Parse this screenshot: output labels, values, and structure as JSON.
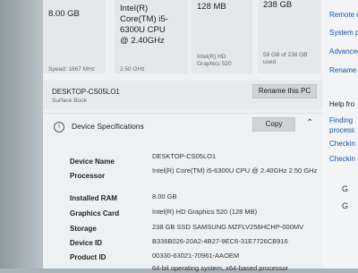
{
  "tiles": [
    {
      "value": "8.00 GB",
      "sub": "Speed: 1867 MHz"
    },
    {
      "value": "Intel(R) Core(TM) i5-6300U CPU @ 2.40GHz",
      "sub": "2.50 GHz"
    },
    {
      "value": "128 MB",
      "sub": "Intel(R) HD Graphics 520"
    },
    {
      "value": "238 GB",
      "sub": "59 GB of 238 GB used"
    }
  ],
  "device": {
    "name": "DESKTOP-CS05LO1",
    "model": "Surface Book",
    "rename_label": "Rename this PC"
  },
  "specs_section": {
    "title": "Device Specifications",
    "copy_label": "Copy",
    "rows": [
      {
        "label": "Device Name",
        "value": "DESKTOP-CS05LO1"
      },
      {
        "label": "Processor",
        "value": "Intel(R) Core(TM) i5-6300U CPU @ 2.40GHz 2.50 GHz"
      },
      {
        "label": "Installed RAM",
        "value": "8.00 GB"
      },
      {
        "label": "Graphics Card",
        "value": "Intel(R) HD Graphics 520 (128 MB)"
      },
      {
        "label": "Storage",
        "value": "238 GB SSD SAMSUNG MZFLV256HCHP-000MV"
      },
      {
        "label": "Device ID",
        "value": "B336B026-20A2-4B27-9EC6-31E7726CB916"
      },
      {
        "label": "Product ID",
        "value": "00330-63021-70961-AAOEM"
      },
      {
        "label": "",
        "value": "64-bit operating system, x64-based processor"
      }
    ]
  },
  "sidebar": {
    "links": [
      "Remote de",
      "System pr",
      "Advanced",
      "Rename"
    ],
    "help_title": "Help fro",
    "help_links": [
      "Finding",
      "process",
      "Checkin",
      "Checkin"
    ],
    "icons": [
      "help-chat-icon",
      "feedback-icon"
    ],
    "icon_texts": [
      "G",
      "G"
    ]
  }
}
